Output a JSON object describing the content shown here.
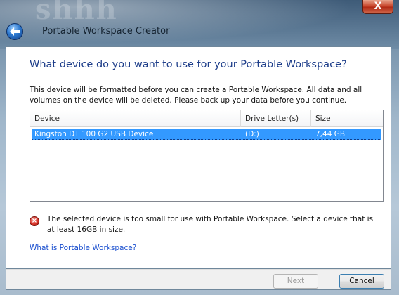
{
  "window": {
    "title": "Portable Workspace Creator",
    "background_word": "shhh"
  },
  "heading": "What device do you want to use for your Portable Workspace?",
  "description": "This device will be formatted before you can create a Portable Workspace. All data and all volumes on the device will be deleted. Please back up your data before you continue.",
  "device_list": {
    "columns": [
      "Device",
      "Drive Letter(s)",
      "Size"
    ],
    "rows": [
      {
        "device": "Kingston DT 100 G2 USB Device",
        "drive": "(D:)",
        "size": "7,44 GB",
        "selected": true
      }
    ]
  },
  "error_message": "The selected device is too small for use with Portable Workspace. Select a device that is at least 16GB in size.",
  "help_link": "What is Portable Workspace?",
  "buttons": {
    "next": "Next",
    "cancel": "Cancel",
    "close": "X"
  },
  "icons": {
    "back": "back-arrow-icon",
    "error": "error-icon",
    "close": "close-icon"
  },
  "colors": {
    "heading": "#1e3e8a",
    "selection": "#3399ff",
    "link": "#1a4fcf",
    "close_button": "#c8452b"
  }
}
